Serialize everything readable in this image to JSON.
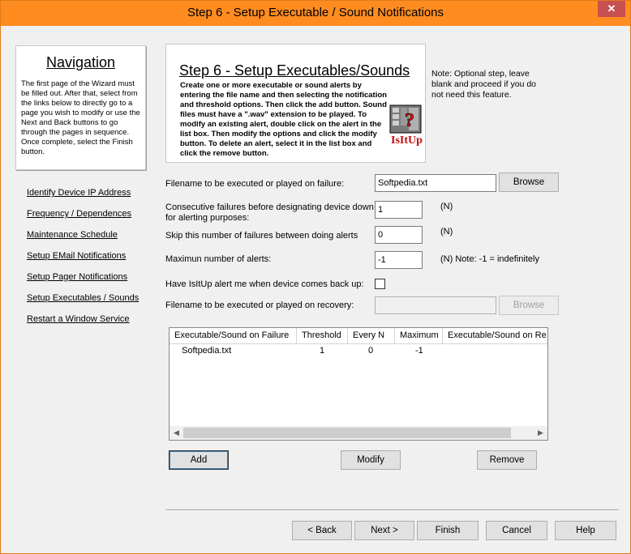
{
  "window": {
    "title": "Step 6 - Setup Executable / Sound Notifications",
    "close_glyph": "✕",
    "accent_color": "#ff8c21"
  },
  "navigation": {
    "title": "Navigation",
    "description": "The first page of the Wizard must be filled out. After that, select from the links below to directly go to a page you wish to modify or use the Next and Back buttons to go through the pages in sequence. Once complete, select the Finish button.",
    "links": [
      "Identify Device IP Address",
      "Frequency / Dependences",
      "Maintenance Schedule",
      "Setup EMail Notifications",
      "Setup Pager Notifications",
      "Setup Executables / Sounds",
      "Restart a Window Service"
    ]
  },
  "banner": {
    "title": "Step 6 - Setup Executables/Sounds",
    "text": "Create one or more executable or sound alerts by entering the file name and then selecting the notification and threshold options. Then click the add button. Sound files must have  a \".wav\" extension to be played. To modify an existing alert, double click on the alert in the list box. Then modify the options and click the modify button. To delete an alert, select it in the list box and click the remove button.",
    "logo_text": "IsItUp",
    "note": "Note: Optional step, leave blank and proceed if you do not need this feature."
  },
  "form": {
    "failure_file_label": "Filename to be executed or played on failure:",
    "failure_file_value": "Softpedia.txt",
    "browse_label": "Browse",
    "consecutive_label_line1": "Consecutive failures before designating device down",
    "consecutive_label_line2": "for alerting purposes:",
    "consecutive_value": "1",
    "consecutive_unit": "(N)",
    "skip_label": "Skip this number of failures between doing alerts",
    "skip_value": "0",
    "skip_unit": "(N)",
    "max_alerts_label": "Maximun number of alerts:",
    "max_alerts_value": "-1",
    "max_alerts_unit": "(N) Note: -1 = indefinitely",
    "back_up_label": "Have IsItUp alert me when device comes back up:",
    "back_up_checked": false,
    "recovery_file_label": "Filename to be executed or played on recovery:",
    "recovery_file_value": "",
    "recovery_browse_label": "Browse"
  },
  "list": {
    "columns": [
      "Executable/Sound on Failure",
      "Threshold",
      "Every N",
      "Maximum",
      "Executable/Sound on Re"
    ],
    "rows": [
      {
        "file": "Softpedia.txt",
        "threshold": "1",
        "every_n": "0",
        "maximum": "-1",
        "recovery": ""
      }
    ]
  },
  "actions": {
    "add": "Add",
    "modify": "Modify",
    "remove": "Remove"
  },
  "footer": {
    "back": "< Back",
    "next": "Next >",
    "finish": "Finish",
    "cancel": "Cancel",
    "help": "Help"
  }
}
